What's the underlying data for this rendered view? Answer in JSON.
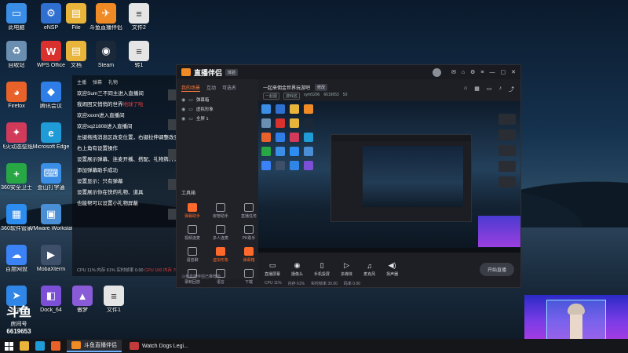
{
  "desktop": {
    "icons": [
      {
        "label": "此电脑",
        "icon": "computer-icon",
        "color": "#3a8ee6",
        "glyph": "▭"
      },
      {
        "label": "eNSP",
        "icon": "ensp-icon",
        "color": "#2f6fd0",
        "glyph": "⚙"
      },
      {
        "label": "File",
        "icon": "folder-icon",
        "color": "#e8b43a",
        "glyph": "▤"
      },
      {
        "label": "斗鱼直播伴侣",
        "icon": "douyu-companion-icon",
        "color": "#f08a24",
        "glyph": "✈"
      },
      {
        "label": "文件2",
        "icon": "document-icon",
        "color": "#e5e5e5",
        "glyph": "≡"
      },
      {
        "label": "回收站",
        "icon": "recycle-bin-icon",
        "color": "#6a8fb0",
        "glyph": "♻"
      },
      {
        "label": "WPS Office",
        "icon": "wps-icon",
        "color": "#d9312d",
        "glyph": "W"
      },
      {
        "label": "文档",
        "icon": "folder-icon",
        "color": "#e8b43a",
        "glyph": "▤"
      },
      {
        "label": "Steam",
        "icon": "steam-icon",
        "color": "#1b2838",
        "glyph": "◉"
      },
      {
        "label": "转1",
        "icon": "document-icon",
        "color": "#e5e5e5",
        "glyph": "≡"
      },
      {
        "label": "Firefox",
        "icon": "firefox-icon",
        "color": "#e8622a",
        "glyph": "◕"
      },
      {
        "label": "腾讯会议",
        "icon": "tencent-meeting-icon",
        "color": "#2f7de6",
        "glyph": "◆"
      },
      {
        "label": "飞火动态壁纸",
        "icon": "wallpaper-app-icon",
        "color": "#d23a5a",
        "glyph": "✦"
      },
      {
        "label": "Microsoft Edge",
        "icon": "edge-icon",
        "color": "#1f9bd8",
        "glyph": "e"
      },
      {
        "label": "360安全卫士",
        "icon": "security-360-icon",
        "color": "#27a845",
        "glyph": "+"
      },
      {
        "label": "金山打字通",
        "icon": "typing-app-icon",
        "color": "#3a8ee6",
        "glyph": "⌨"
      },
      {
        "label": "360软件管家",
        "icon": "software-manager-icon",
        "color": "#2d8cf0",
        "glyph": "▦"
      },
      {
        "label": "VMware Workstati...",
        "icon": "vmware-icon",
        "color": "#4a8ed6",
        "glyph": "▣"
      },
      {
        "label": "百度网盘",
        "icon": "baidu-netdisk-icon",
        "color": "#3b82f6",
        "glyph": "☁"
      },
      {
        "label": "MobaXterm",
        "icon": "mobaxterm-icon",
        "color": "#3e4f6a",
        "glyph": "▶"
      },
      {
        "label": "迅雷",
        "icon": "thunder-icon",
        "color": "#2f86e6",
        "glyph": "➤"
      },
      {
        "label": "Dock_64",
        "icon": "dock-icon",
        "color": "#7b4fd6",
        "glyph": "◧"
      },
      {
        "label": "傲梦",
        "icon": "aomeng-icon",
        "color": "#8a5bd6",
        "glyph": "▲"
      },
      {
        "label": "文件1",
        "icon": "document-icon",
        "color": "#e5e5e5",
        "glyph": "≡"
      }
    ]
  },
  "chat": {
    "header": [
      "主播",
      "弹幕",
      "礼物"
    ],
    "lines": [
      {
        "text": "欢迎Sum三不同主进入直播间",
        "hl": ""
      },
      {
        "text": "我闹困又悄悄的世界",
        "hl": "地球了啦"
      },
      {
        "text": "欢迎xxxm进入直播间",
        "hl": ""
      },
      {
        "text": "欢迎sq21808进入直播间",
        "hl": ""
      },
      {
        "text": "左键拖拽消息区改变位置，右键拉伸调整改变大小",
        "hl": ""
      },
      {
        "text": "右上角有设置操作",
        "hl": ""
      },
      {
        "text": "设置展示弹幕、连麦开播、搭配、礼物牌升级等",
        "hl": ""
      },
      {
        "text": "添加弹幕助手成功",
        "hl": ""
      },
      {
        "text": "设置显示：只有弹幕",
        "hl": ""
      },
      {
        "text": "设置展示你在快的礼物、道具",
        "hl": ""
      },
      {
        "text": "也能帮可以设置小礼物屏蔽",
        "hl": ""
      }
    ],
    "footer": "CPU 11%  内存 61%  实时帧率 0.00",
    "footer_red": "CPU 100  内存 70%"
  },
  "app": {
    "title": "直播伴侣",
    "title_badge": "体验",
    "tabs": [
      "我的场景",
      "互动",
      "可选名"
    ],
    "scenes": [
      "弹幕箱",
      "虚拟形象",
      "全屏 1"
    ],
    "toolbox_label": "工具箱",
    "tools": [
      {
        "label": "弹幕助手",
        "orange": true
      },
      {
        "label": "房管助手",
        "orange": false
      },
      {
        "label": "直播任务",
        "orange": false
      },
      {
        "label": "视频连麦",
        "orange": false
      },
      {
        "label": "多人连麦",
        "orange": false
      },
      {
        "label": "PK助手",
        "orange": false
      },
      {
        "label": "语音聊",
        "orange": false
      },
      {
        "label": "虚拟形象",
        "orange": true
      },
      {
        "label": "弹幕箱",
        "orange": true
      },
      {
        "label": "录制回放",
        "orange": false
      },
      {
        "label": "语言",
        "orange": false
      },
      {
        "label": "下载",
        "orange": false
      }
    ],
    "left_bottom": "斗鱼直播伴侣已推荐版",
    "stream": {
      "title": "一起来佣金世界玩游吧",
      "badge": "修改",
      "meta": [
        "一起图",
        "游戏名",
        "xym5206",
        "6619653",
        "50"
      ]
    },
    "controls": [
      {
        "label": "直播屏幕",
        "glyph": "▭"
      },
      {
        "label": "摄像头",
        "glyph": "◉"
      },
      {
        "label": "手机投屏",
        "glyph": "▯"
      },
      {
        "label": "多媒体",
        "glyph": "▷"
      },
      {
        "label": "麦克风",
        "glyph": "♫"
      },
      {
        "label": "扬声器",
        "glyph": "◀)"
      }
    ],
    "start_button": "开始直播",
    "stats": [
      "CPU 11%",
      "内存 61%",
      "实时帧率 30.00",
      "码率 0.00"
    ]
  },
  "watermark": {
    "mark": "斗鱼",
    "room_label": "房间号",
    "room_id": "6619653"
  },
  "taskbar": {
    "items": [
      {
        "label": "斗鱼直播伴侣",
        "active": true,
        "color": "#f08a24"
      },
      {
        "label": "Watch Dogs Legi...",
        "active": false,
        "color": "#c23a3a"
      }
    ]
  }
}
